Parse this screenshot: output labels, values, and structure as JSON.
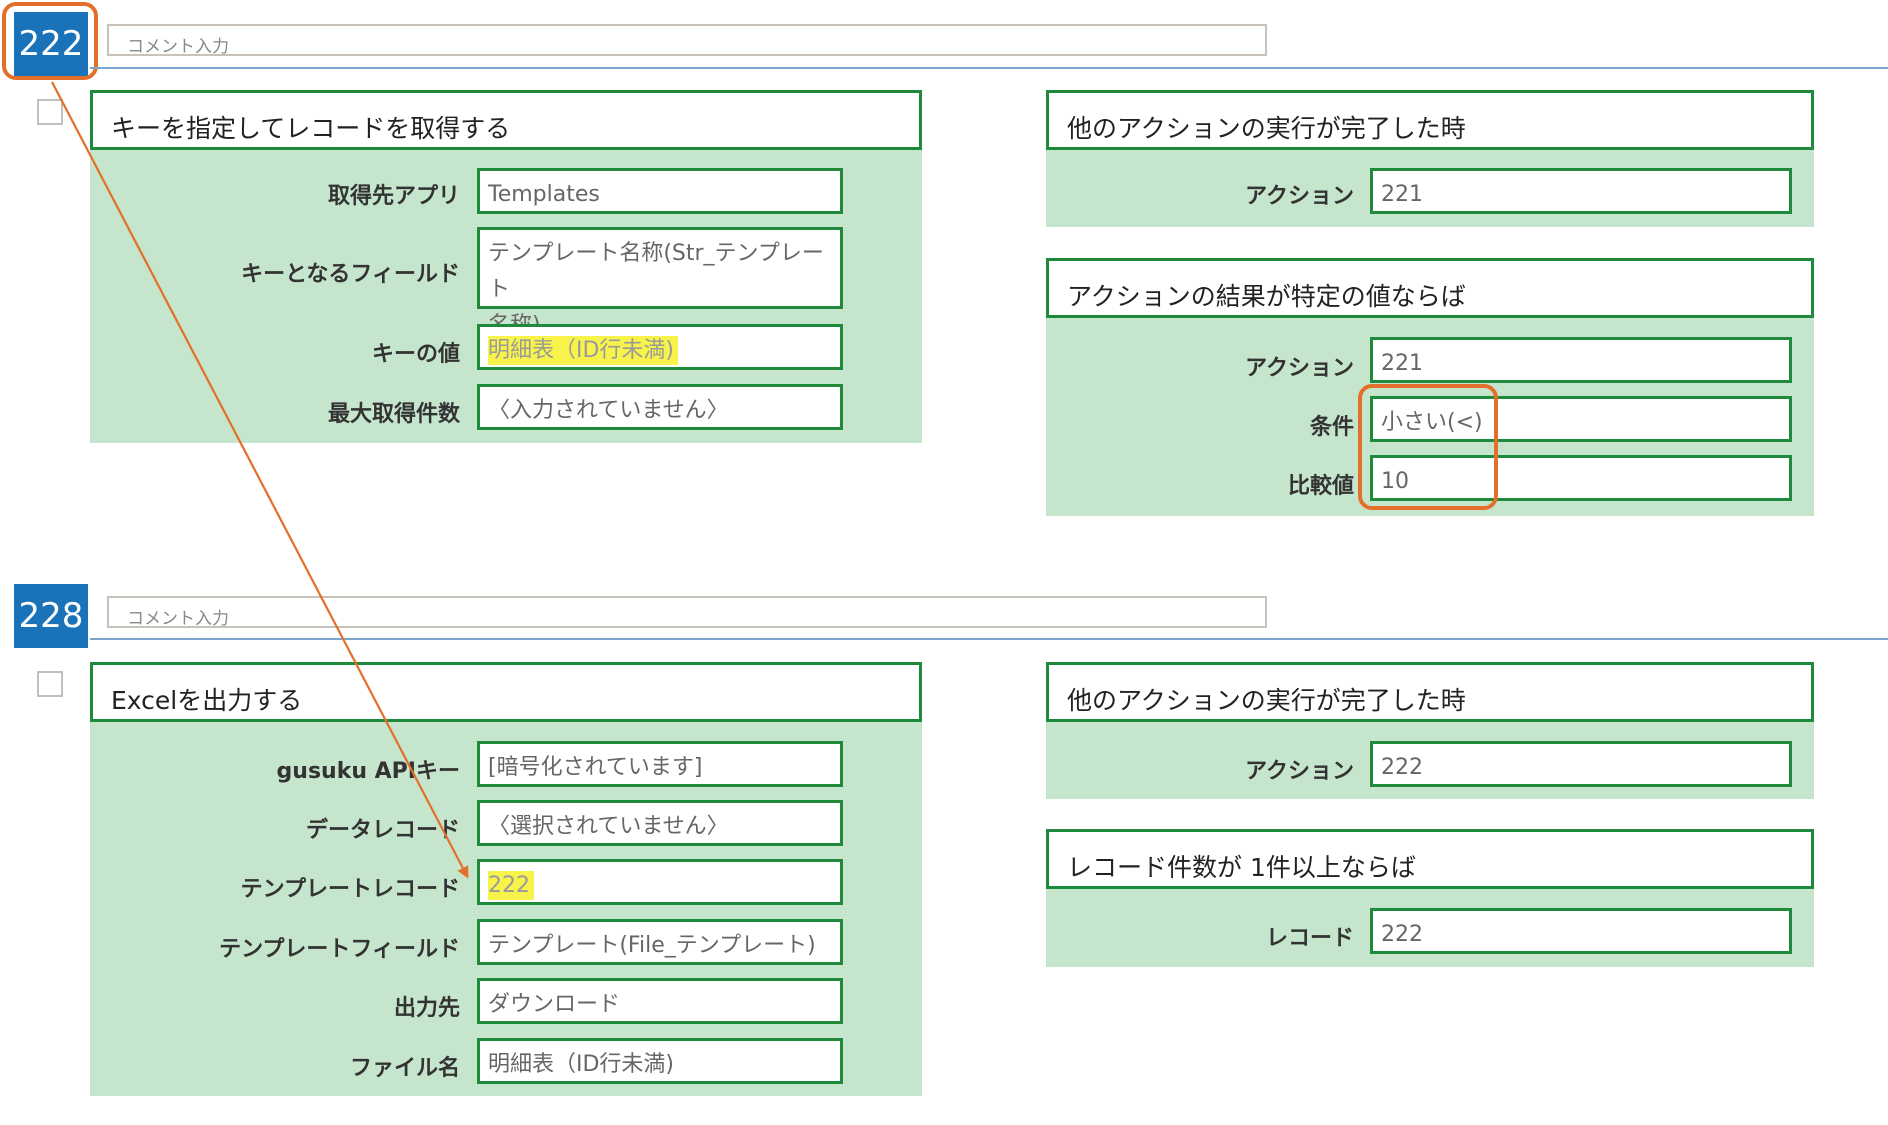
{
  "section1": {
    "number": "222",
    "comment_placeholder": "コメント入力",
    "left_panel": {
      "title": "キーを指定してレコードを取得する",
      "fields": [
        {
          "label": "取得先アプリ",
          "value": "Templates"
        },
        {
          "label": "キーとなるフィールド",
          "value_line1": "テンプレート名称(Str_テンプレート",
          "value_line2": "名称)"
        },
        {
          "label": "キーの値",
          "value": "明細表（ID行未満)",
          "highlighted": true
        },
        {
          "label": "最大取得件数",
          "value": "〈入力されていません〉"
        }
      ]
    },
    "right_panel_1": {
      "title": "他のアクションの実行が完了した時",
      "fields": [
        {
          "label": "アクション",
          "value": "221"
        }
      ]
    },
    "right_panel_2": {
      "title": "アクションの結果が特定の値ならば",
      "fields": [
        {
          "label": "アクション",
          "value": "221"
        },
        {
          "label": "条件",
          "value": "小さい(<)"
        },
        {
          "label": "比較値",
          "value": "10"
        }
      ]
    }
  },
  "section2": {
    "number": "228",
    "comment_placeholder": "コメント入力",
    "left_panel": {
      "title": "Excelを出力する",
      "fields": [
        {
          "label": "gusuku APIキー",
          "value": "[暗号化されています]"
        },
        {
          "label": "データレコード",
          "value": "〈選択されていません〉"
        },
        {
          "label": "テンプレートレコード",
          "value": "222",
          "highlighted": true
        },
        {
          "label": "テンプレートフィールド",
          "value": "テンプレート(File_テンプレート)"
        },
        {
          "label": "出力先",
          "value": "ダウンロード"
        },
        {
          "label": "ファイル名",
          "value": "明細表（ID行未満)"
        }
      ]
    },
    "right_panel_1": {
      "title": "他のアクションの実行が完了した時",
      "fields": [
        {
          "label": "アクション",
          "value": "222"
        }
      ]
    },
    "right_panel_2": {
      "title": "レコード件数が 1件以上ならば",
      "fields": [
        {
          "label": "レコード",
          "value": "222"
        }
      ]
    }
  },
  "colors": {
    "badge": "#1a72b8",
    "panel_bg": "#c5e6cd",
    "border_green": "#1f8a3c",
    "highlight": "#f7f34a",
    "annotation_orange": "#e2702a"
  }
}
